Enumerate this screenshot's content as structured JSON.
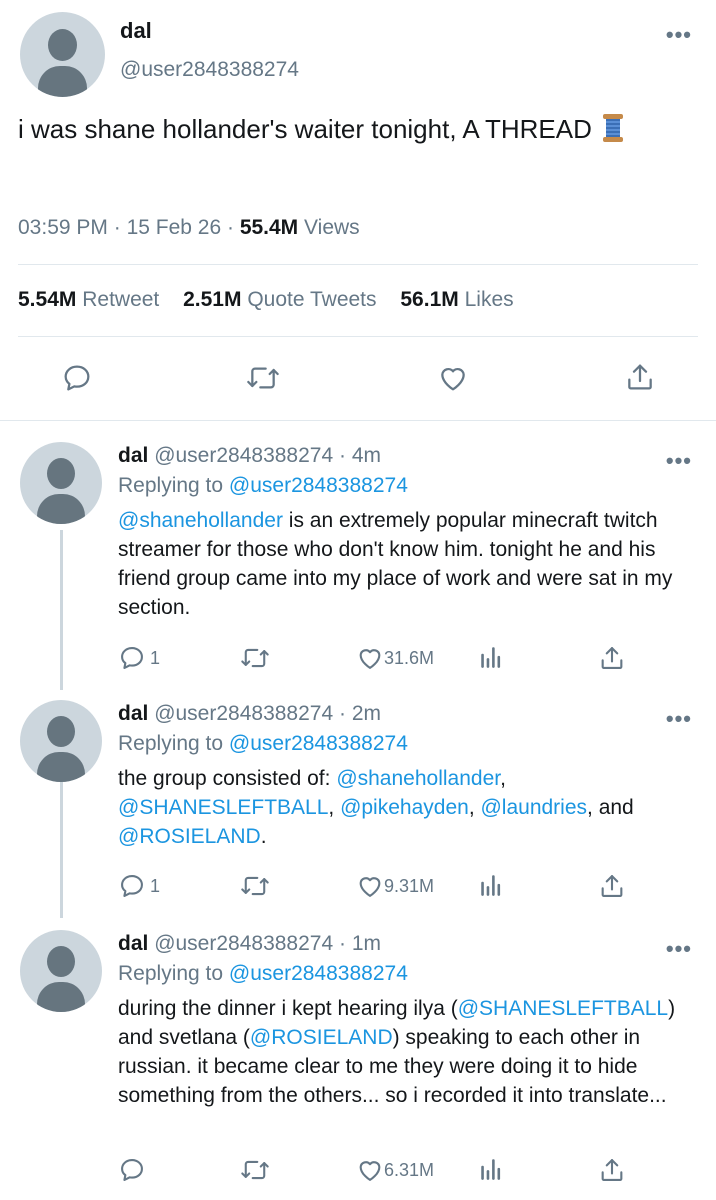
{
  "main": {
    "name": "dal",
    "handle": "@user2848388274",
    "text": "i was shane hollander's waiter tonight, A THREAD",
    "time": "03:59 PM",
    "date": "15 Feb 26",
    "views_count": "55.4M",
    "views_label": "Views",
    "retweets_count": "5.54M",
    "retweets_label": "Retweet",
    "quotes_count": "2.51M",
    "quotes_label": "Quote Tweets",
    "likes_count": "56.1M",
    "likes_label": "Likes"
  },
  "replies": [
    {
      "name": "dal",
      "handle": "@user2848388274",
      "time": "4m",
      "replying_prefix": "Replying to",
      "replying_to": "@user2848388274",
      "reply_count": "1",
      "like_count": "31.6M"
    },
    {
      "name": "dal",
      "handle": "@user2848388274",
      "time": "2m",
      "replying_prefix": "Replying to",
      "replying_to": "@user2848388274",
      "reply_count": "1",
      "like_count": "9.31M"
    },
    {
      "name": "dal",
      "handle": "@user2848388274",
      "time": "1m",
      "replying_prefix": "Replying to",
      "replying_to": "@user2848388274",
      "reply_count": "",
      "like_count": "6.31M"
    }
  ],
  "reply_texts": {
    "r1": {
      "m1": "@shanehollander",
      "t1": " is an extremely popular minecraft twitch streamer for those who don't know him. tonight he and his friend group came into my place of work and were sat in my section."
    },
    "r2": {
      "t1": "the group consisted of: ",
      "m1": "@shanehollander",
      "t2": ", ",
      "m2": "@SHANESLEFTBALL",
      "t3": ", ",
      "m3": "@pikehayden",
      "t4": ", ",
      "m4": "@laundries",
      "t5": ", and ",
      "m5": "@ROSIELAND",
      "t6": "."
    },
    "r3": {
      "t1": "during the dinner i kept hearing ilya (",
      "m1": "@SHANESLEFTBALL",
      "t2": ") and svetlana (",
      "m2": "@ROSIELAND",
      "t3": ") speaking to each other in russian. it became clear to me they were doing it to hide something from the others... so i recorded it into translate..."
    }
  },
  "icons": {
    "more": "more-horizontal-icon",
    "reply": "reply-bubble-icon",
    "retweet": "retweet-icon",
    "like": "heart-icon",
    "analytics": "analytics-bars-icon",
    "share": "share-upload-icon",
    "thread": "spool-of-thread-icon"
  },
  "colors": {
    "link": "#1b95e0",
    "secondary_text": "#657786",
    "primary_text": "#14171a",
    "divider": "#e1e8ed"
  }
}
